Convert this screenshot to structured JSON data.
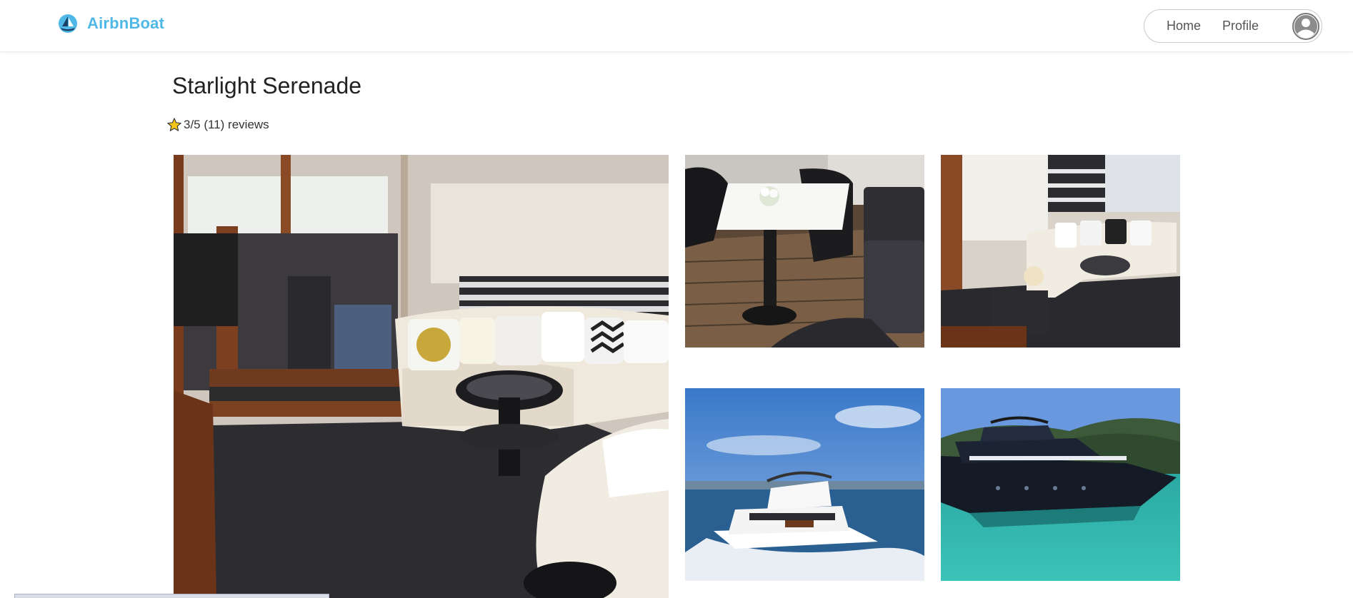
{
  "header": {
    "brand_name": "AirbnBoat",
    "nav": {
      "home_label": "Home",
      "profile_label": "Profile"
    }
  },
  "listing": {
    "title": "Starlight Serenade",
    "rating_text": "3/5 (11) reviews"
  },
  "gallery": {
    "main": "photo-yacht-salon-interior",
    "thumbs": [
      "photo-helm-dining-area",
      "photo-lounge-sofa",
      "photo-yacht-cruising",
      "photo-yacht-anchored"
    ]
  },
  "colors": {
    "brand": "#4fb8e6",
    "star": "#f5c518",
    "nav_border": "#c9c9c9"
  }
}
